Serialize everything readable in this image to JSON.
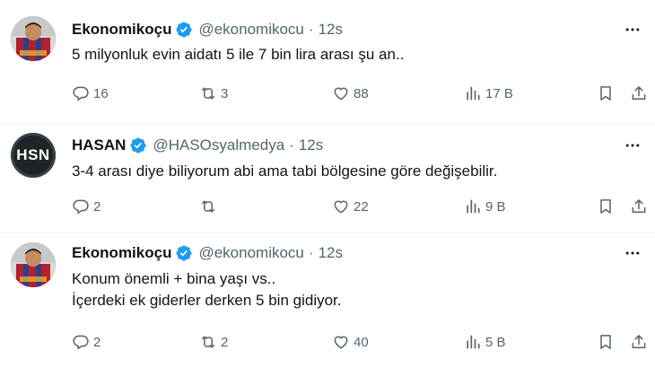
{
  "tweets": [
    {
      "name": "Ekonomikoçu",
      "handle": "@ekonomikocu",
      "separator": "·",
      "time": "12s",
      "lines": [
        "5 milyonluk evin aidatı 5 ile 7 bin lira arası şu an.."
      ],
      "replies": "16",
      "retweets": "3",
      "likes": "88",
      "views": "17 B"
    },
    {
      "name": "HASAN",
      "handle": "@HASOsyalmedya",
      "separator": "·",
      "time": "12s",
      "avatar_text": "HSN",
      "lines": [
        "3-4 arası diye biliyorum abi ama tabi bölgesine göre değişebilir."
      ],
      "replies": "2",
      "retweets": "",
      "likes": "22",
      "views": "9 B"
    },
    {
      "name": "Ekonomikoçu",
      "handle": "@ekonomikocu",
      "separator": "·",
      "time": "12s",
      "lines": [
        "Konum önemli + bina yaşı vs..",
        "İçerdeki ek giderler derken 5 bin gidiyor."
      ],
      "replies": "2",
      "retweets": "2",
      "likes": "40",
      "views": "5 B"
    }
  ],
  "colors": {
    "verified": "#1d9bf0",
    "muted": "#536471",
    "text": "#0f1419",
    "divider": "#eff3f4"
  },
  "icons": [
    "verified-badge-icon",
    "more-icon",
    "reply-icon",
    "retweet-icon",
    "like-icon",
    "views-icon",
    "bookmark-icon",
    "share-icon"
  ]
}
